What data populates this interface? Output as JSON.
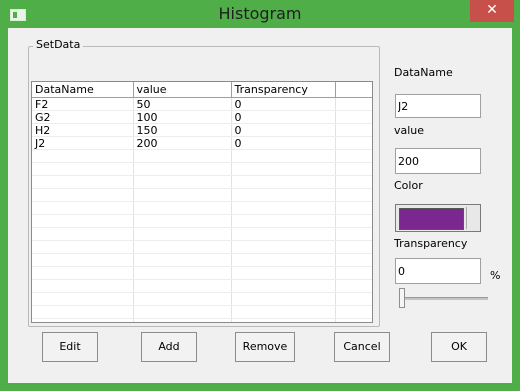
{
  "window": {
    "title": "Histogram",
    "close_glyph": "✕"
  },
  "group": {
    "label": "SetData"
  },
  "grid": {
    "columns": [
      "DataName",
      "value",
      "Transparency",
      ""
    ],
    "rows": [
      [
        "F2",
        "50",
        "0",
        ""
      ],
      [
        "G2",
        "100",
        "0",
        ""
      ],
      [
        "H2",
        "150",
        "0",
        ""
      ],
      [
        "J2",
        "200",
        "0",
        ""
      ]
    ],
    "empty_rows": 17
  },
  "form": {
    "dataname_label": "DataName",
    "dataname_value": "J2",
    "value_label": "value",
    "value_value": "200",
    "color_label": "Color",
    "color_value": "#7b2790",
    "transparency_label": "Transparency",
    "transparency_value": "0",
    "transparency_unit": "%",
    "transparency_level": 0
  },
  "buttons": {
    "edit": "Edit",
    "add": "Add",
    "remove": "Remove",
    "cancel": "Cancel",
    "ok": "OK"
  },
  "colors": {
    "titlebar": "#4fae48",
    "close_button": "#c7504a"
  }
}
